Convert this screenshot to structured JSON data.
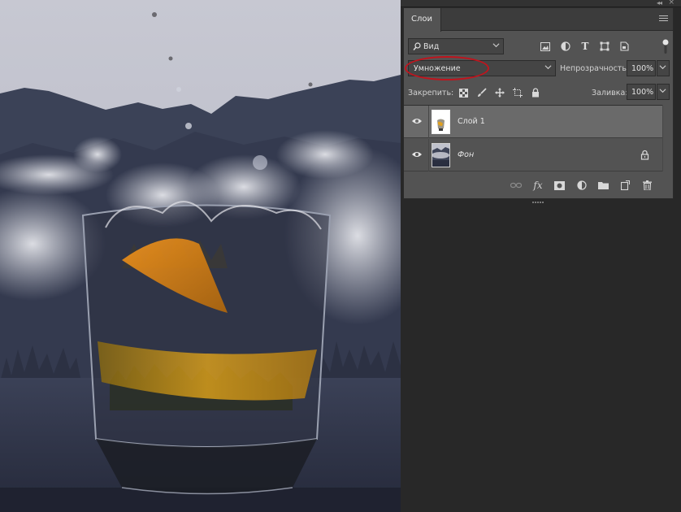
{
  "panel": {
    "tab_label": "Слои",
    "filter": {
      "label": "Вид"
    },
    "blend_mode": {
      "value": "Умножение"
    },
    "opacity": {
      "label": "Непрозрачность:",
      "value": "100%"
    },
    "lock": {
      "label": "Закрепить:"
    },
    "fill": {
      "label": "Заливка:",
      "value": "100%"
    },
    "layers": [
      {
        "name": "Слой 1",
        "selected": true,
        "visible": true,
        "locked": false
      },
      {
        "name": "Фон",
        "selected": false,
        "visible": true,
        "locked": true
      }
    ],
    "filter_icons": [
      "pixel-layer-filter-icon",
      "adjustment-layer-filter-icon",
      "type-layer-filter-icon",
      "shape-layer-filter-icon",
      "smart-object-filter-icon"
    ],
    "lock_icons": [
      "lock-transparent-pixels-icon",
      "lock-image-pixels-icon",
      "lock-position-icon",
      "prevent-autonest-icon",
      "lock-all-icon"
    ],
    "footer_icons": [
      "link-layers-icon",
      "layer-style-fx-icon",
      "add-mask-icon",
      "new-adjustment-layer-icon",
      "new-group-icon",
      "new-layer-icon",
      "delete-layer-icon"
    ],
    "highlight_color": "#c0141d"
  }
}
